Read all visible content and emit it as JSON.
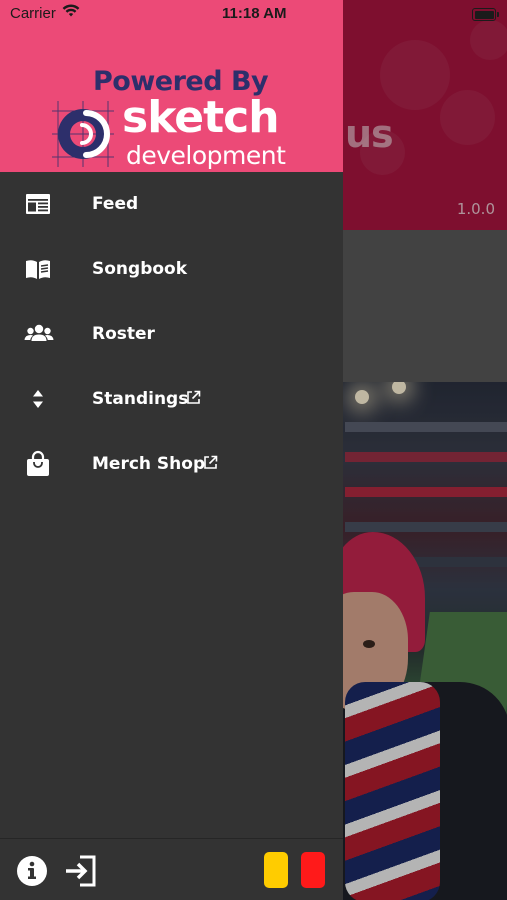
{
  "status_bar": {
    "carrier": "Carrier",
    "time": "11:18 AM"
  },
  "background": {
    "title_fragment": "us",
    "version": "1.0.0"
  },
  "drawer": {
    "brand": {
      "powered_by": "Powered By",
      "name": "sketch",
      "sub": "development"
    },
    "menu": [
      {
        "label": "Feed",
        "icon": "feed-icon",
        "external": false
      },
      {
        "label": "Songbook",
        "icon": "book-icon",
        "external": false
      },
      {
        "label": "Roster",
        "icon": "people-icon",
        "external": false
      },
      {
        "label": "Standings",
        "icon": "sort-icon",
        "external": true
      },
      {
        "label": "Merch Shop",
        "icon": "shopping-bag-icon",
        "external": true
      }
    ],
    "footer": {
      "info": "info-icon",
      "login": "login-icon",
      "cards": [
        "yellow-card-icon",
        "red-card-icon"
      ]
    }
  },
  "colors": {
    "drawer_header": "#ec4a77",
    "drawer_bg": "#333333",
    "brand_navy": "#2d2f6b",
    "app_header": "#a8153f",
    "yellow_card": "#ffcc00",
    "red_card": "#ff1a1a"
  }
}
